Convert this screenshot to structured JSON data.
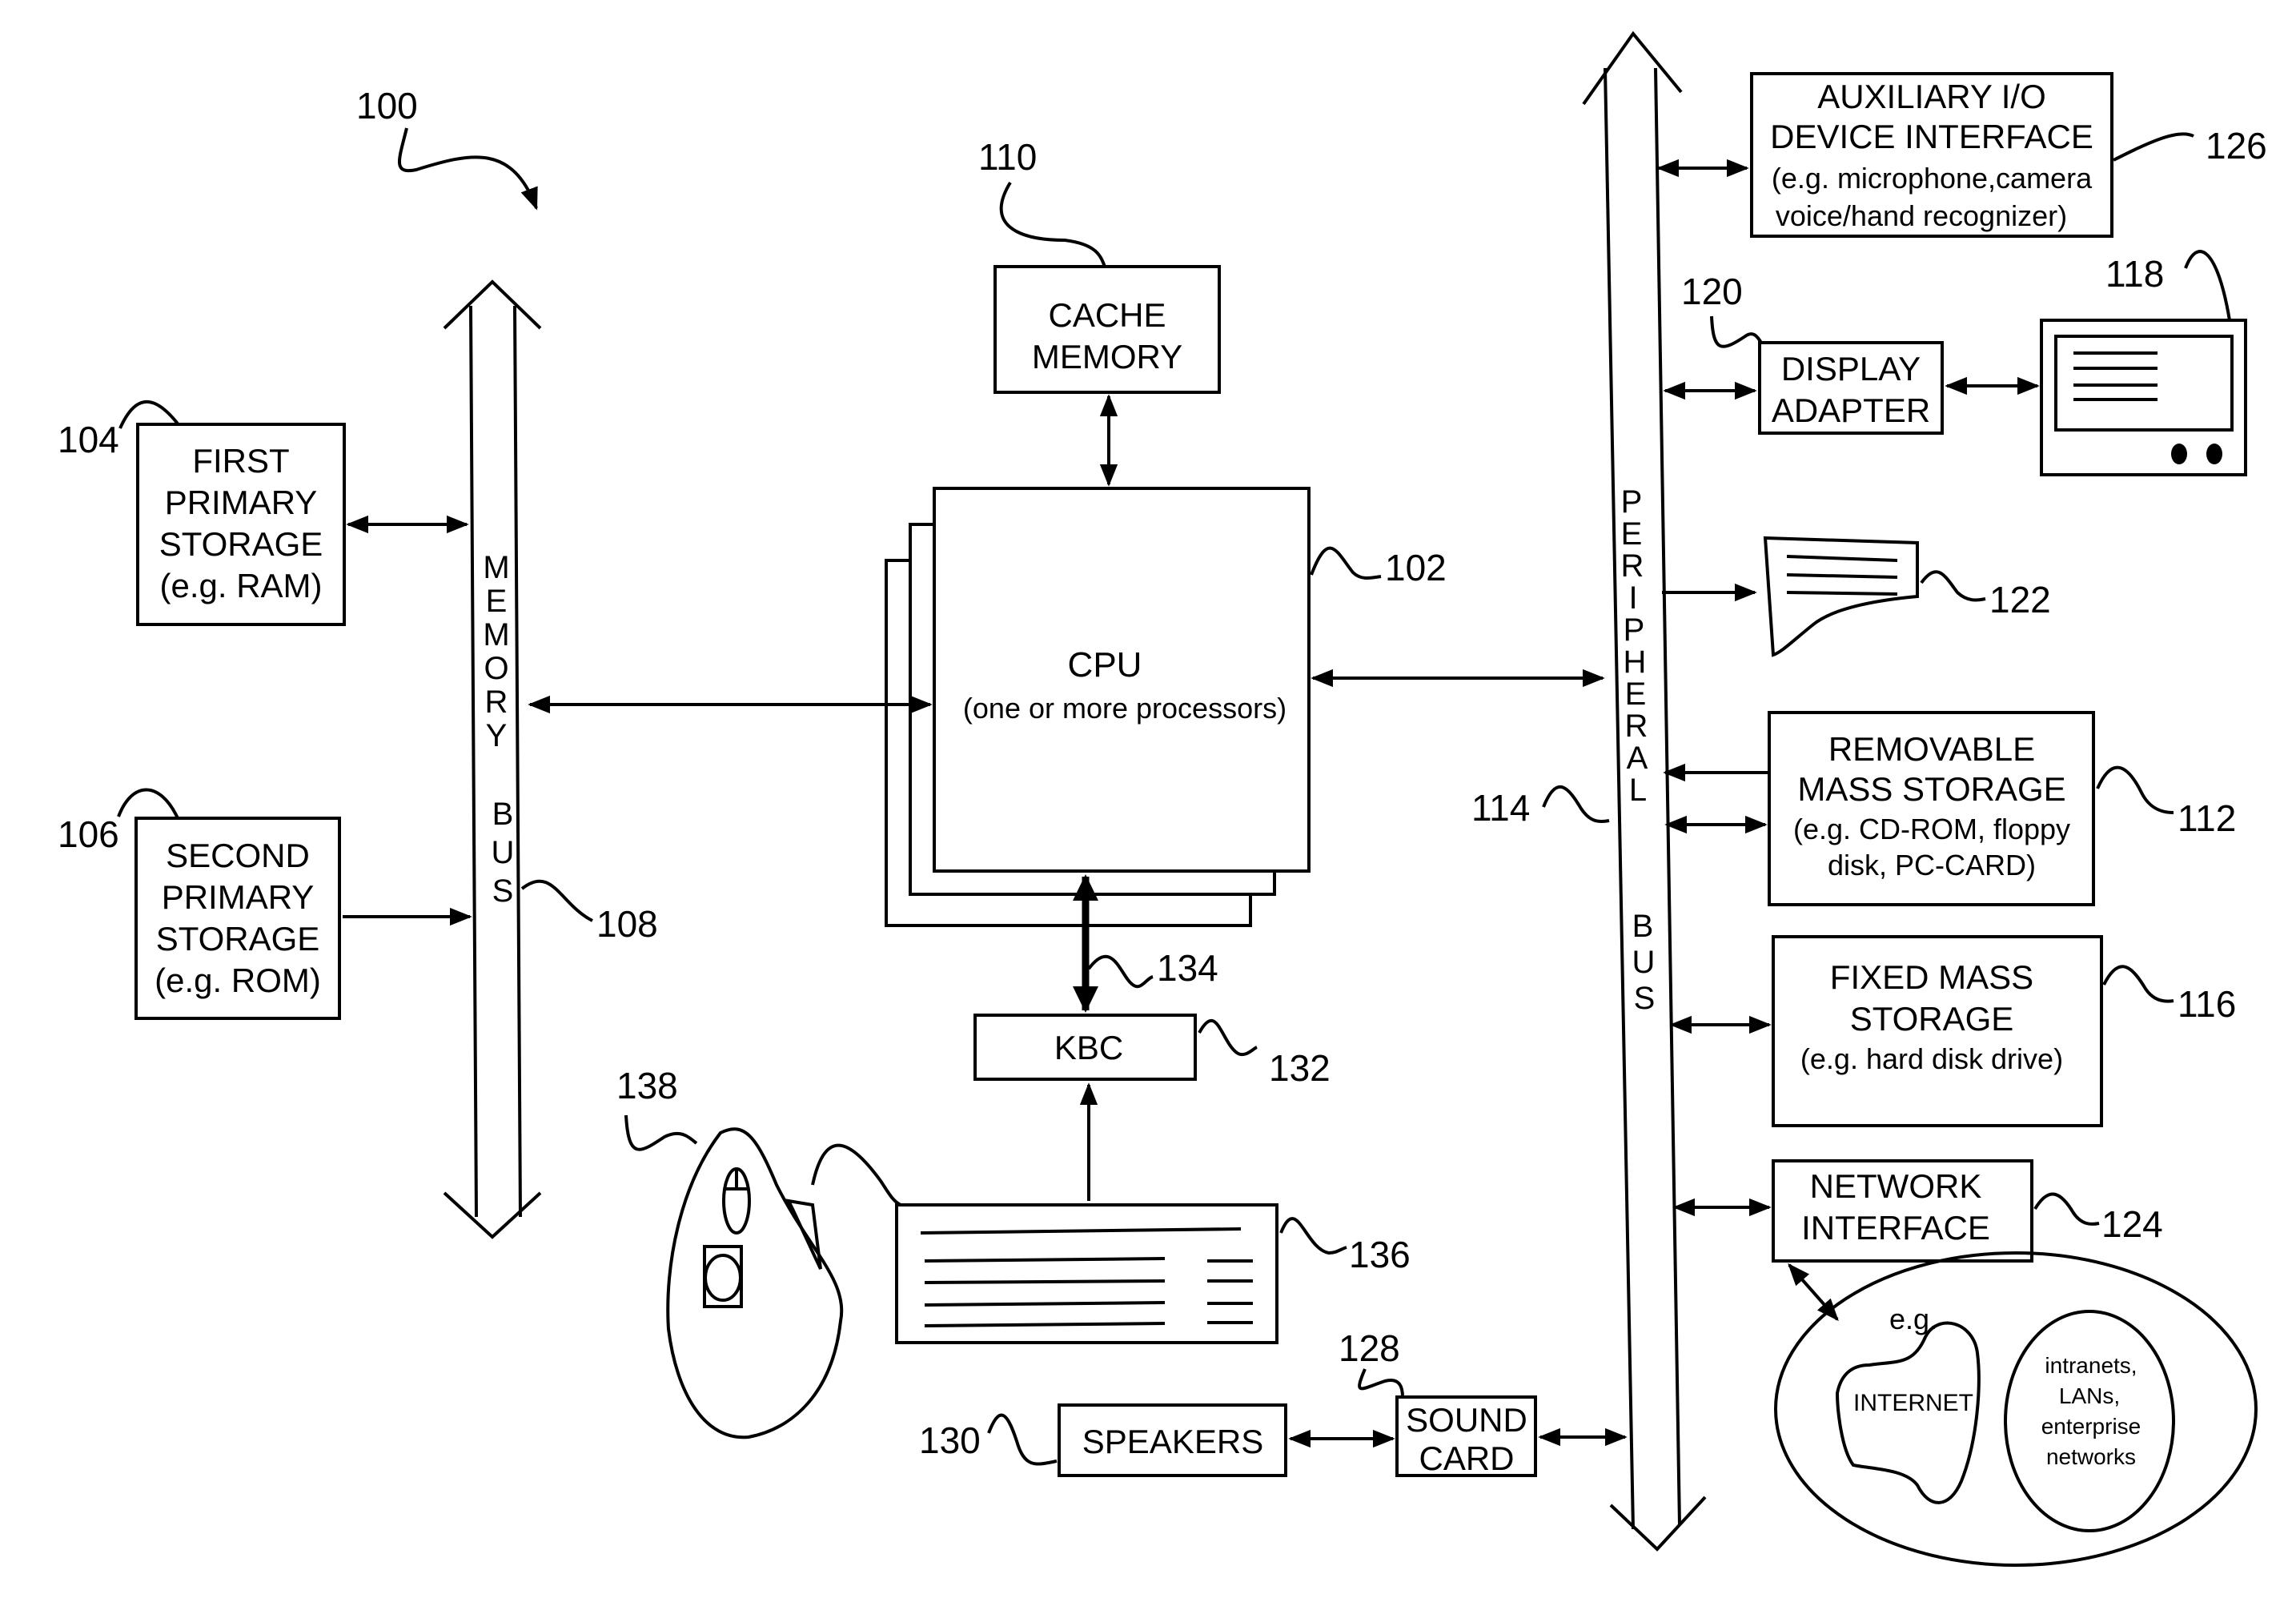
{
  "figure": {
    "ref": "100",
    "memory_bus": {
      "ref": "108",
      "letters_top": [
        "M",
        "E",
        "M",
        "O",
        "R",
        "Y"
      ],
      "letters_bottom": [
        "B",
        "U",
        "S"
      ]
    },
    "peripheral_bus": {
      "ref": "114",
      "letters_top": [
        "P",
        "E",
        "R",
        "I",
        "P",
        "H",
        "E",
        "R",
        "A",
        "L"
      ],
      "letters_bottom": [
        "B",
        "U",
        "S"
      ]
    },
    "first_primary_storage": {
      "ref": "104",
      "lines": [
        "FIRST",
        "PRIMARY",
        "STORAGE",
        "(e.g. RAM)"
      ]
    },
    "second_primary_storage": {
      "ref": "106",
      "lines": [
        "SECOND",
        "PRIMARY",
        "STORAGE",
        "(e.g. ROM)"
      ]
    },
    "cache_memory": {
      "ref": "110",
      "lines": [
        "CACHE",
        "MEMORY"
      ]
    },
    "cpu": {
      "ref": "102",
      "title": "CPU",
      "subtitle": "(one or more processors)"
    },
    "kbc": {
      "ref": "132",
      "label": "KBC"
    },
    "kbc_link": {
      "ref": "134"
    },
    "keyboard": {
      "ref": "136"
    },
    "pointing_devices": {
      "ref": "138"
    },
    "speakers": {
      "ref": "130",
      "label": "SPEAKERS"
    },
    "sound_card": {
      "ref": "128",
      "lines": [
        "SOUND",
        "CARD"
      ]
    },
    "aux_io": {
      "ref": "126",
      "lines": [
        "AUXILIARY I/O",
        "DEVICE INTERFACE",
        "(e.g. microphone,camera",
        "voice/hand recognizer)"
      ]
    },
    "display_adapter": {
      "ref": "120",
      "lines": [
        "DISPLAY",
        "ADAPTER"
      ]
    },
    "display": {
      "ref": "118"
    },
    "printer": {
      "ref": "122"
    },
    "removable_storage": {
      "ref": "112",
      "lines": [
        "REMOVABLE",
        "MASS STORAGE",
        "(e.g. CD-ROM, floppy",
        "disk, PC-CARD)"
      ]
    },
    "fixed_storage": {
      "ref": "116",
      "lines": [
        "FIXED MASS",
        "STORAGE",
        "(e.g. hard disk drive)"
      ]
    },
    "network_interface": {
      "ref": "124",
      "lines": [
        "NETWORK",
        "INTERFACE"
      ]
    },
    "network_cloud": {
      "eg": "e.g.",
      "internet": "INTERNET",
      "others": [
        "intranets,",
        "LANs,",
        "enterprise",
        "networks"
      ]
    }
  }
}
